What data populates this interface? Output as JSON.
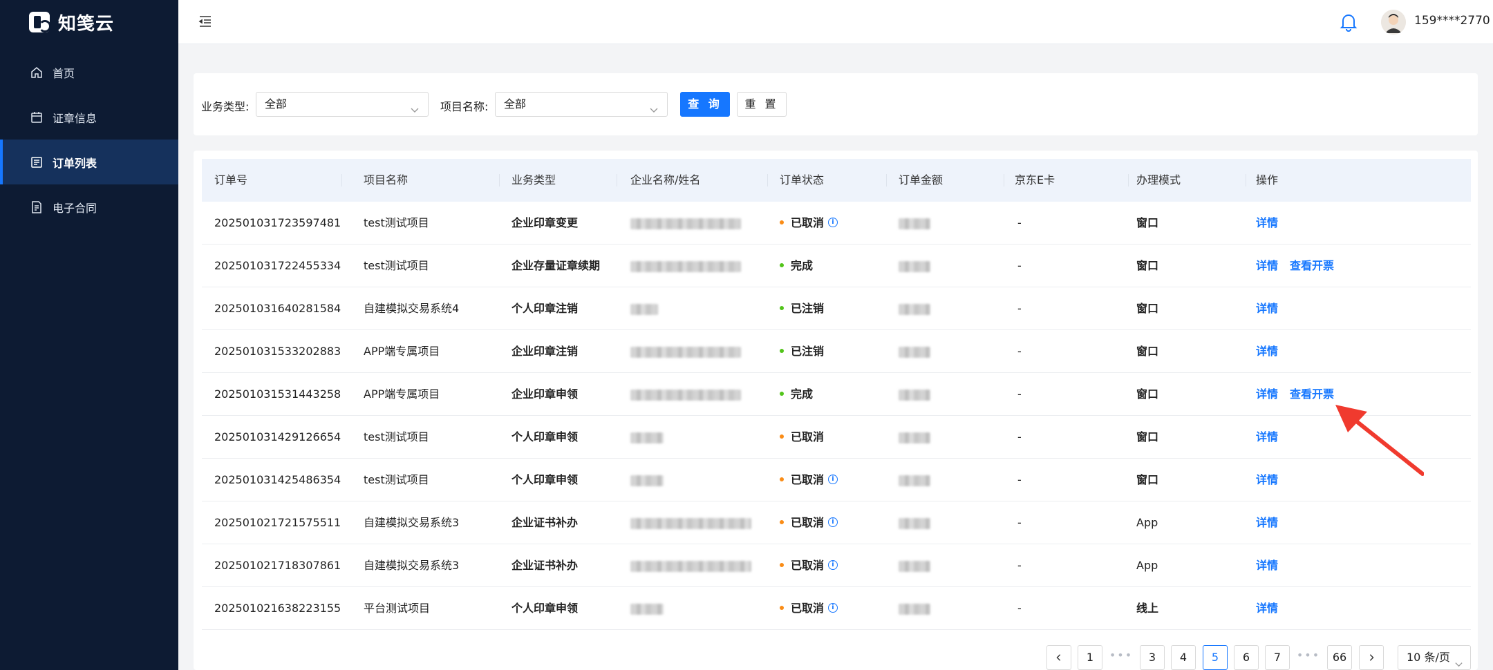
{
  "app": {
    "logo_text": "知笺云"
  },
  "sidebar": {
    "items": [
      {
        "label": "首页",
        "icon": "home-icon",
        "active": false
      },
      {
        "label": "证章信息",
        "icon": "calendar-icon",
        "active": false
      },
      {
        "label": "订单列表",
        "icon": "list-icon",
        "active": true
      },
      {
        "label": "电子合同",
        "icon": "contract-icon",
        "active": false
      }
    ]
  },
  "header": {
    "username": "159****2770"
  },
  "filters": {
    "business_type_label": "业务类型:",
    "business_type_value": "全部",
    "project_name_label": "项目名称:",
    "project_name_value": "全部",
    "query_label": "查 询",
    "reset_label": "重 置"
  },
  "table": {
    "columns": [
      "订单号",
      "项目名称",
      "业务类型",
      "企业名称/姓名",
      "订单状态",
      "订单金额",
      "京东E卡",
      "办理模式",
      "操作"
    ],
    "rows": [
      {
        "order_no": "202501031723597481",
        "project": "test测试项目",
        "biz_type": "企业印章变更",
        "status": "已取消",
        "status_color": "#fa8c16",
        "status_info": true,
        "ecard": "-",
        "mode": "窗口",
        "mode_bold": true,
        "actions": [
          "详情"
        ]
      },
      {
        "order_no": "202501031722455334",
        "project": "test测试项目",
        "biz_type": "企业存量证章续期",
        "status": "完成",
        "status_color": "#52c41a",
        "status_info": false,
        "ecard": "-",
        "mode": "窗口",
        "mode_bold": true,
        "actions": [
          "详情",
          "查看开票"
        ]
      },
      {
        "order_no": "202501031640281584",
        "project": "自建模拟交易系统4",
        "biz_type": "个人印章注销",
        "status": "已注销",
        "status_color": "#52c41a",
        "status_info": false,
        "ecard": "-",
        "mode": "窗口",
        "mode_bold": true,
        "actions": [
          "详情"
        ]
      },
      {
        "order_no": "202501031533202883",
        "project": "APP端专属项目",
        "biz_type": "企业印章注销",
        "status": "已注销",
        "status_color": "#52c41a",
        "status_info": false,
        "ecard": "-",
        "mode": "窗口",
        "mode_bold": true,
        "actions": [
          "详情"
        ]
      },
      {
        "order_no": "202501031531443258",
        "project": "APP端专属项目",
        "biz_type": "企业印章申领",
        "status": "完成",
        "status_color": "#52c41a",
        "status_info": false,
        "ecard": "-",
        "mode": "窗口",
        "mode_bold": true,
        "actions": [
          "详情",
          "查看开票"
        ]
      },
      {
        "order_no": "202501031429126654",
        "project": "test测试项目",
        "biz_type": "个人印章申领",
        "status": "已取消",
        "status_color": "#fa8c16",
        "status_info": false,
        "ecard": "-",
        "mode": "窗口",
        "mode_bold": true,
        "actions": [
          "详情"
        ]
      },
      {
        "order_no": "202501031425486354",
        "project": "test测试项目",
        "biz_type": "个人印章申领",
        "status": "已取消",
        "status_color": "#fa8c16",
        "status_info": true,
        "ecard": "-",
        "mode": "窗口",
        "mode_bold": true,
        "actions": [
          "详情"
        ]
      },
      {
        "order_no": "202501021721575511",
        "project": "自建模拟交易系统3",
        "biz_type": "企业证书补办",
        "status": "已取消",
        "status_color": "#fa8c16",
        "status_info": true,
        "ecard": "-",
        "mode": "App",
        "mode_bold": false,
        "actions": [
          "详情"
        ]
      },
      {
        "order_no": "202501021718307861",
        "project": "自建模拟交易系统3",
        "biz_type": "企业证书补办",
        "status": "已取消",
        "status_color": "#fa8c16",
        "status_info": true,
        "ecard": "-",
        "mode": "App",
        "mode_bold": false,
        "actions": [
          "详情"
        ]
      },
      {
        "order_no": "202501021638223155",
        "project": "平台测试项目",
        "biz_type": "个人印章申领",
        "status": "已取消",
        "status_color": "#fa8c16",
        "status_info": true,
        "ecard": "-",
        "mode": "线上",
        "mode_bold": true,
        "actions": [
          "详情"
        ]
      }
    ]
  },
  "pagination": {
    "pages": [
      "1",
      "3",
      "4",
      "5",
      "6",
      "7",
      "66"
    ],
    "current": "5",
    "page_size_label": "10 条/页"
  },
  "colors": {
    "sidebar_bg": "#0d1b33",
    "primary": "#1677ff",
    "annotation_arrow": "#f03a2e"
  }
}
